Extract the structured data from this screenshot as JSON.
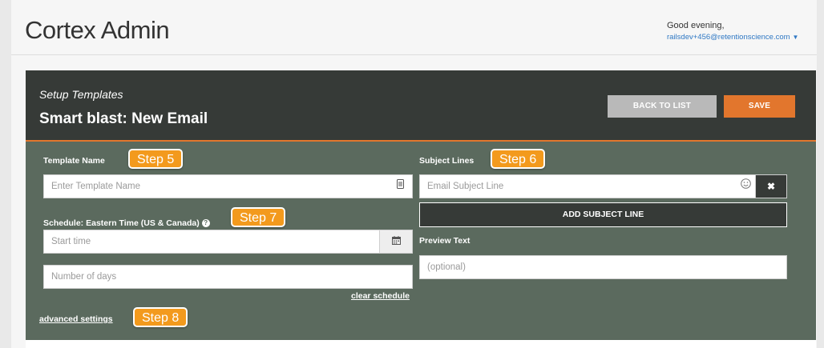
{
  "app": {
    "title": "Cortex Admin",
    "greeting": "Good evening,",
    "user_email": "railsdev+456@retentionscience.com"
  },
  "header": {
    "section_label": "Setup Templates",
    "title_prefix": "Smart blast:",
    "title_name": "New Email",
    "back_button": "BACK TO LIST",
    "save_button": "SAVE"
  },
  "form": {
    "template_name": {
      "label": "Template Name",
      "placeholder": "Enter Template Name",
      "icon": "document-icon"
    },
    "schedule": {
      "label": "Schedule: Eastern Time (US & Canada)",
      "start_placeholder": "Start time",
      "days_placeholder": "Number of days",
      "clear_link": "clear schedule",
      "calendar_icon": "calendar-icon"
    },
    "subject_lines": {
      "label": "Subject Lines",
      "placeholder": "Email Subject Line",
      "emoji_icon": "smiley-icon",
      "remove_label": "✖",
      "add_button": "ADD SUBJECT LINE"
    },
    "preview_text": {
      "label": "Preview Text",
      "placeholder": "(optional)"
    },
    "advanced_link": "advanced settings"
  },
  "steps": {
    "step5": "Step 5",
    "step6": "Step 6",
    "step7": "Step 7",
    "step8": "Step 8"
  },
  "colors": {
    "accent": "#e2762d",
    "header_bg": "#363a37",
    "panel_bg": "#5b6a5e",
    "step_badge": "#f39a1d",
    "link_blue": "#2f78c4"
  }
}
